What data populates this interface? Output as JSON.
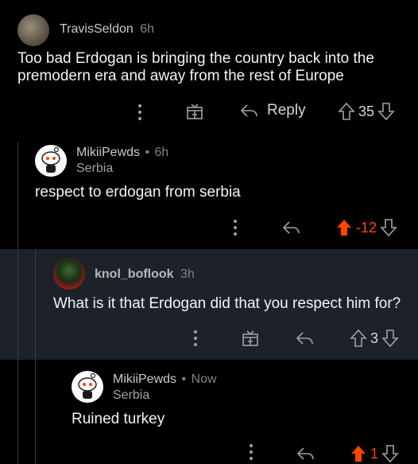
{
  "comments": [
    {
      "username": "TravisSeldon",
      "age": "6h",
      "body_lines": [
        "Too bad Erdogan is bringing the country back into the",
        "premodern era and away from the rest of Europe"
      ],
      "reply_label": "Reply",
      "score": "35"
    },
    {
      "username": "MikiiPewds",
      "separator": "•",
      "age": "6h",
      "flair": "Serbia",
      "body": "respect to erdogan from serbia",
      "score": "-12",
      "vote_state": "upvoted"
    },
    {
      "username": "knol_boflook",
      "age": "3h",
      "body": "What is it that Erdogan did that you respect him for?",
      "score": "3"
    },
    {
      "username": "MikiiPewds",
      "separator": "•",
      "age": "Now",
      "flair": "Serbia",
      "body": "Ruined turkey",
      "score": "1",
      "vote_state": "upvoted"
    }
  ],
  "colors": {
    "background": "#000000",
    "highlight": "#1d2228",
    "upvote": "#ff4500"
  },
  "icons": [
    "overflow-menu-icon",
    "award-icon",
    "reply-icon",
    "upvote-icon",
    "downvote-icon"
  ]
}
